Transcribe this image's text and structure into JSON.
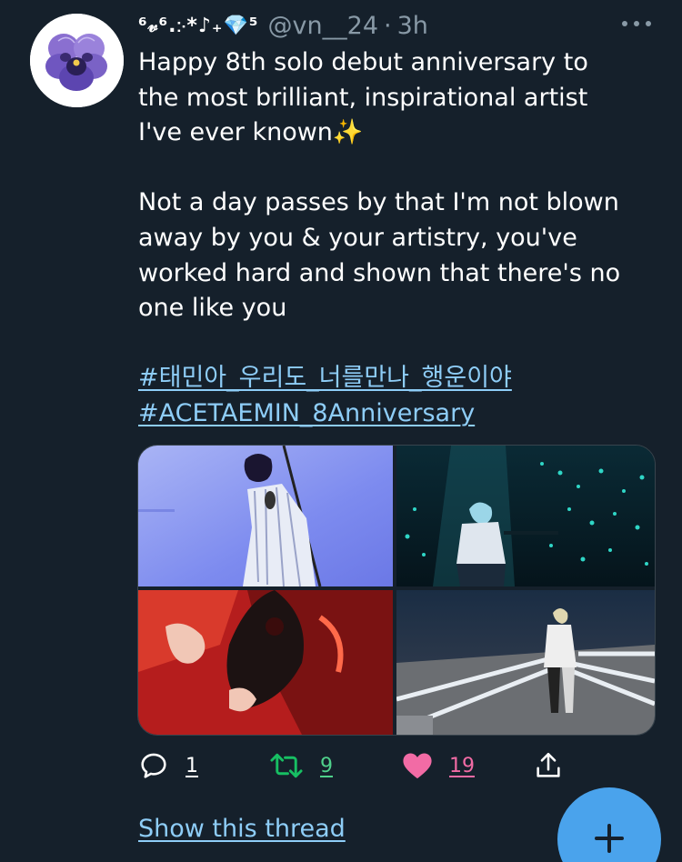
{
  "tweet": {
    "display_name": "⁶𝓋⁶.჻*♪₊💎⁵",
    "handle": "@vn__24",
    "separator": "·",
    "time": "3h",
    "text_para1": "Happy 8th solo debut anniversary to\nthe most brilliant, inspirational artist\nI've ever known✨",
    "text_para2": "Not a day passes by that I'm not blown\naway by you & your artistry, you've\nworked hard and shown that there's no\none like you",
    "hashtags": [
      "#태민아_우리도_너를만나_행운이야",
      "#ACETAEMIN_8Anniversary"
    ]
  },
  "actions": {
    "reply_count": "1",
    "retweet_count": "9",
    "like_count": "19"
  },
  "show_thread_label": "Show this thread",
  "colors": {
    "background": "#15202b",
    "link": "#8ecdf7",
    "retweet": "#17bf63",
    "like": "#f26ba5",
    "fab": "#4aa3ec"
  },
  "icons": {
    "more": "more-horizontal-icon",
    "reply": "reply-icon",
    "retweet": "retweet-icon",
    "like": "heart-filled-icon",
    "share": "share-icon",
    "compose": "plus-icon"
  }
}
